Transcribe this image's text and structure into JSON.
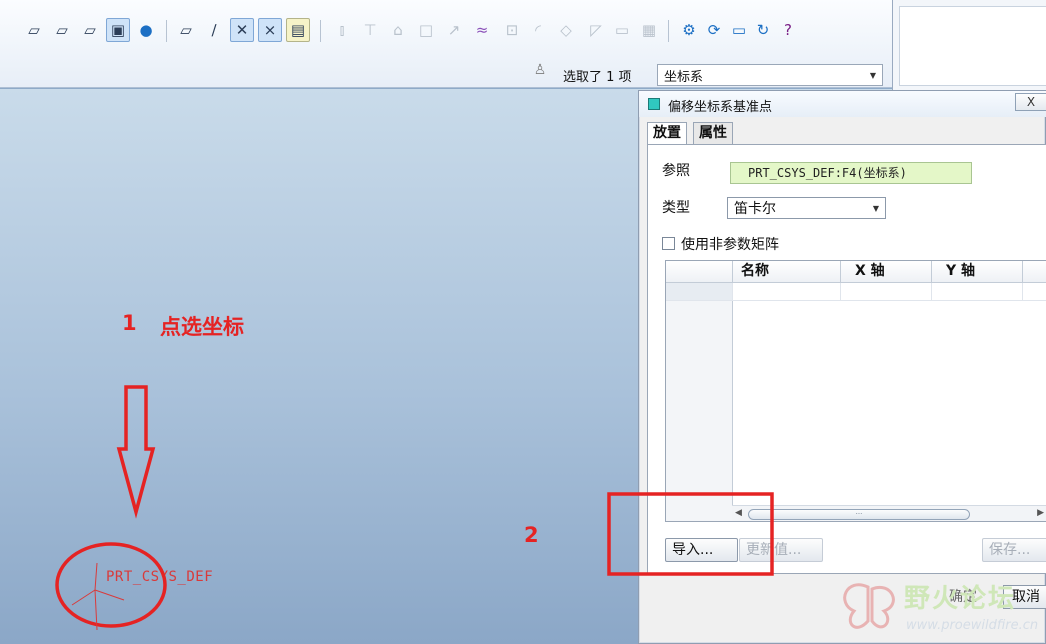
{
  "toolbar": {
    "icons": [
      "box-front-icon",
      "box-top-icon",
      "box-right-icon",
      "shaded-view-icon",
      "appearance-icon",
      "datum-plane-icon",
      "datum-axis-icon",
      "datum-point-icon",
      "csys-display-icon",
      "tag-display-icon",
      "mirror-icon",
      "trim-icon",
      "merge-icon",
      "rectangle-icon",
      "offset-icon",
      "curve-icon",
      "insert-icon",
      "fillet-icon",
      "shell-icon",
      "draft-icon",
      "frame-icon",
      "grid-icon",
      "settings-gear-icon",
      "regen-icon",
      "folder-icon",
      "refresh-icon",
      "help-icon"
    ],
    "selection_status": "选取了 1 项",
    "filter": {
      "value": "坐标系"
    }
  },
  "canvas": {
    "annotation_step1_number": "1",
    "annotation_step1_text": "点选坐标",
    "annotation_step2_number": "2",
    "csys_label": "PRT_CSYS_DEF"
  },
  "dialog": {
    "title": "偏移坐标系基准点",
    "close_label": "X",
    "tabs": [
      {
        "label": "放置"
      },
      {
        "label": "属性"
      }
    ],
    "reference_label": "参照",
    "reference_value": "PRT_CSYS_DEF:F4(坐标系)",
    "type_label": "类型",
    "type_value": "笛卡尔",
    "nonparam_label": "使用非参数矩阵",
    "nonparam_checked": false,
    "table": {
      "columns": [
        "名称",
        "X 轴",
        "Y 轴",
        ""
      ],
      "rows": []
    },
    "scroll_thumb": "···",
    "import_button": "导入...",
    "update_button": "更新值...",
    "save_button": "保存...",
    "ok_label": "确定",
    "cancel_label": "取消"
  },
  "watermark": {
    "text": "野火论坛",
    "url": "www.proewildfire.cn"
  },
  "colors": {
    "annotation": "#e52323",
    "reference_field": "#e4f7c8"
  }
}
